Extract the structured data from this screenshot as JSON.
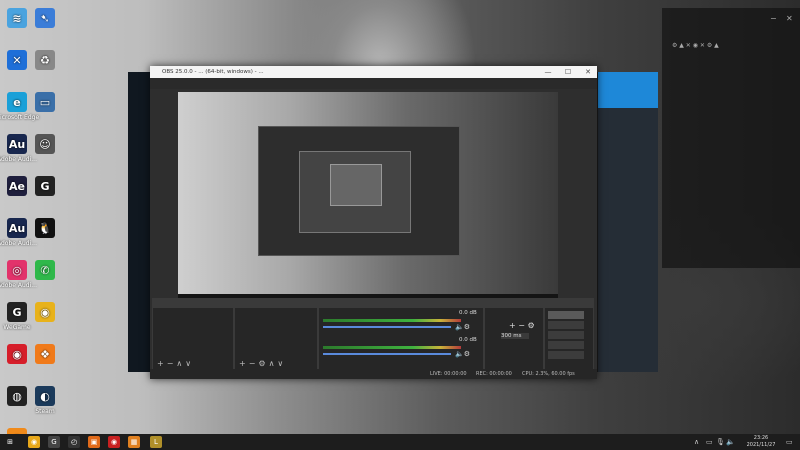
{
  "desktop_icons": [
    {
      "label": "",
      "color": "#4aa3df",
      "glyph": "≋"
    },
    {
      "label": "",
      "color": "#3b7dd8",
      "glyph": "➷"
    },
    {
      "label": "",
      "color": "#1e6fd8",
      "glyph": "✕"
    },
    {
      "label": "",
      "color": "#888888",
      "glyph": "♻"
    },
    {
      "label": "Microsoft Edge",
      "color": "#1aa0d8",
      "glyph": "e"
    },
    {
      "label": "",
      "color": "#3a6fa8",
      "glyph": "▭"
    },
    {
      "label": "Adobe Audi...",
      "color": "#18274e",
      "glyph": "Au"
    },
    {
      "label": "",
      "color": "#555555",
      "glyph": "☺"
    },
    {
      "label": "",
      "color": "#1f1f3d",
      "glyph": "Ae"
    },
    {
      "label": "",
      "color": "#222222",
      "glyph": "G"
    },
    {
      "label": "Adobe Audi...",
      "color": "#18274e",
      "glyph": "Au"
    },
    {
      "label": "",
      "color": "#111111",
      "glyph": "🐧"
    },
    {
      "label": "Adobe Audi...",
      "color": "#e2336b",
      "glyph": "◎"
    },
    {
      "label": "",
      "color": "#2fb84a",
      "glyph": "✆"
    },
    {
      "label": "WeGame",
      "color": "#222222",
      "glyph": "G"
    },
    {
      "label": "",
      "color": "#e8b21a",
      "glyph": "◉"
    },
    {
      "label": "",
      "color": "#d61e2a",
      "glyph": "◉"
    },
    {
      "label": "",
      "color": "#f07a1a",
      "glyph": "❖"
    },
    {
      "label": "",
      "color": "#222222",
      "glyph": "◍"
    },
    {
      "label": "Steam",
      "color": "#1b3a5b",
      "glyph": "◐"
    },
    {
      "label": "",
      "color": "#f08a1a",
      "glyph": "◓"
    }
  ],
  "right_panel": {
    "title": "",
    "lines": [
      "",
      "",
      "",
      "",
      "",
      "",
      "",
      "",
      "",
      ""
    ]
  },
  "obs": {
    "title": "OBS 25.0.0 - ... (64-bit, windows) - ...",
    "menu": [
      "",
      "",
      "",
      "",
      "",
      "",
      "",
      ""
    ],
    "docks": {
      "scenes": {
        "header": "",
        "items": [
          ""
        ]
      },
      "sources": {
        "header": "",
        "items": [
          "",
          ""
        ]
      },
      "mixer": {
        "header": "",
        "channels": [
          {
            "name": "",
            "db": "0.0 dB"
          },
          {
            "name": "",
            "db": "0.0 dB"
          }
        ]
      },
      "transitions": {
        "header": "",
        "type": "",
        "duration_label": "",
        "duration_value": "300 ms"
      },
      "controls": {
        "header": "",
        "buttons": [
          "",
          "",
          "",
          "",
          ""
        ]
      }
    },
    "status": {
      "live": "LIVE: 00:00:00",
      "rec": "REC: 00:00:00",
      "cpu": "CPU: 2.3%, 60.00 fps"
    }
  },
  "taskbar": {
    "apps": [
      {
        "color": "#ffffff",
        "glyph": "⊞"
      },
      {
        "color": "#e8a81a",
        "glyph": "◉"
      },
      {
        "color": "#444444",
        "glyph": "G"
      },
      {
        "color": "#333333",
        "glyph": "◴"
      },
      {
        "color": "#e06a1a",
        "glyph": "▣"
      },
      {
        "color": "#c82020",
        "glyph": "◉"
      },
      {
        "color": "#e08020",
        "glyph": "▦"
      },
      {
        "color": "#b0902a",
        "glyph": "L"
      }
    ],
    "clock_time": "23:26",
    "clock_date": "2021/11/27"
  }
}
